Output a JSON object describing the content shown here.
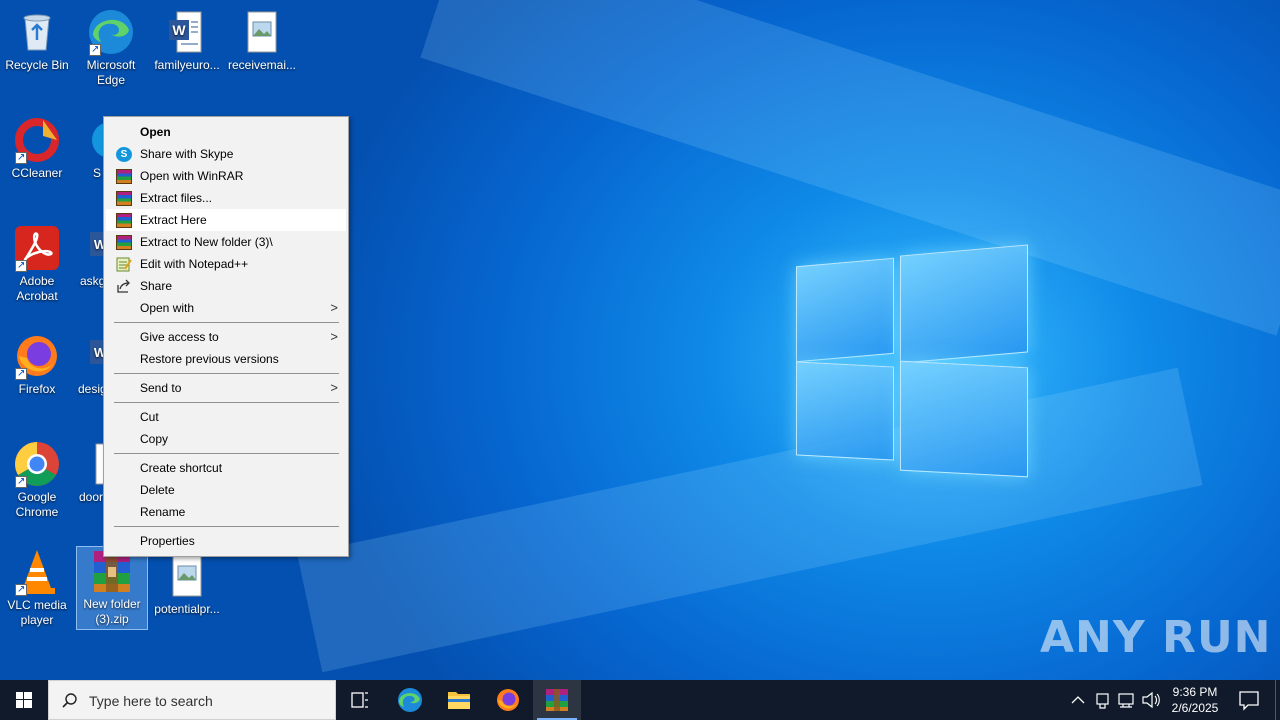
{
  "desktop_icons": [
    {
      "label": "Recycle Bin"
    },
    {
      "label": "Microsoft Edge"
    },
    {
      "label": "familyeuro..."
    },
    {
      "label": "receivemai..."
    },
    {
      "label": "CCleaner"
    },
    {
      "label": "S"
    },
    {
      "label": "Adobe Acrobat"
    },
    {
      "label": "askg"
    },
    {
      "label": "Firefox"
    },
    {
      "label": "desig"
    },
    {
      "label": "Google Chrome"
    },
    {
      "label": "door"
    },
    {
      "label": "VLC media player"
    },
    {
      "label": "New folder (3).zip"
    },
    {
      "label": "potentialpr..."
    }
  ],
  "context_menu": {
    "items": [
      {
        "label": "Open"
      },
      {
        "label": "Share with Skype"
      },
      {
        "label": "Open with WinRAR"
      },
      {
        "label": "Extract files..."
      },
      {
        "label": "Extract Here"
      },
      {
        "label": "Extract to New folder (3)\\"
      },
      {
        "label": "Edit with Notepad++"
      },
      {
        "label": "Share"
      },
      {
        "label": "Open with"
      },
      {
        "label": "Give access to"
      },
      {
        "label": "Restore previous versions"
      },
      {
        "label": "Send to"
      },
      {
        "label": "Cut"
      },
      {
        "label": "Copy"
      },
      {
        "label": "Create shortcut"
      },
      {
        "label": "Delete"
      },
      {
        "label": "Rename"
      },
      {
        "label": "Properties"
      }
    ]
  },
  "watermark": "ANY RUN",
  "taskbar": {
    "search_placeholder": "Type here to search",
    "clock_time": "9:36 PM",
    "clock_date": "2/6/2025",
    "accent_color": "#78b4ff"
  }
}
